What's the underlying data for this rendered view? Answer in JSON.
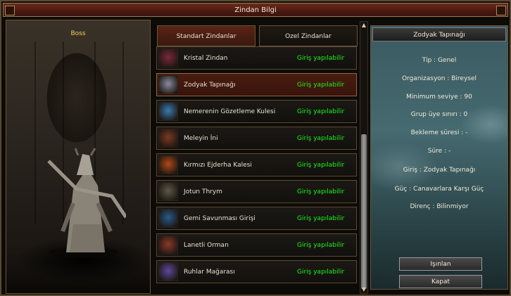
{
  "window": {
    "title": "Zindan Bilgi"
  },
  "boss": {
    "label": "Boss"
  },
  "tabs": [
    {
      "label": "Standart Zindanlar",
      "active": true
    },
    {
      "label": "Ozel Zindanlar",
      "active": false
    }
  ],
  "dungeons": [
    {
      "name": "Kristal Zindan",
      "status": "Giriş yapılabilir",
      "icon": "crystal-beast-icon",
      "color": "#7a2a3a"
    },
    {
      "name": "Zodyak Tapınağı",
      "status": "Giriş yapılabilir",
      "icon": "zodiac-warrior-icon",
      "color": "#8a8aa0",
      "selected": true
    },
    {
      "name": "Nemerenin Gözetleme Kulesi",
      "status": "Giriş yapılabilir",
      "icon": "nemere-icon",
      "color": "#3a7ab0"
    },
    {
      "name": "Meleyin İni",
      "status": "Giriş yapılabilir",
      "icon": "meley-lair-icon",
      "color": "#7a3a20"
    },
    {
      "name": "Kırmızı Ejderha Kalesi",
      "status": "Giriş yapılabilir",
      "icon": "red-dragon-icon",
      "color": "#b04a18"
    },
    {
      "name": "Jotun Thrym",
      "status": "Giriş yapılabilir",
      "icon": "jotun-icon",
      "color": "#5a5a48"
    },
    {
      "name": "Gemi Savunması Girişi",
      "status": "Giriş yapılabilir",
      "icon": "ship-defense-icon",
      "color": "#2a5a8a"
    },
    {
      "name": "Lanetli Orman",
      "status": "Giriş yapılabilir",
      "icon": "cursed-forest-icon",
      "color": "#8a3a2a"
    },
    {
      "name": "Ruhlar Mağarası",
      "status": "Giriş yapılabilir",
      "icon": "spirit-cave-icon",
      "color": "#5a4a9a"
    }
  ],
  "info": {
    "title": "Zodyak Tapınağı",
    "lines": [
      "Tip : Genel",
      "Organizasyon : Bireysel",
      "Minimum seviye : 90",
      "Grup üye sınırı : 0",
      "Bekleme süresi :  -",
      "Süre :  -",
      "Giriş : Zodyak Tapınağı",
      "Güç : Canavarlara Karşı Güç",
      "Direnç : Bilinmiyor"
    ]
  },
  "buttons": {
    "teleport": "Işınlan",
    "close": "Kapat"
  },
  "scrollbar": {
    "up": "▲",
    "down": "▼"
  }
}
